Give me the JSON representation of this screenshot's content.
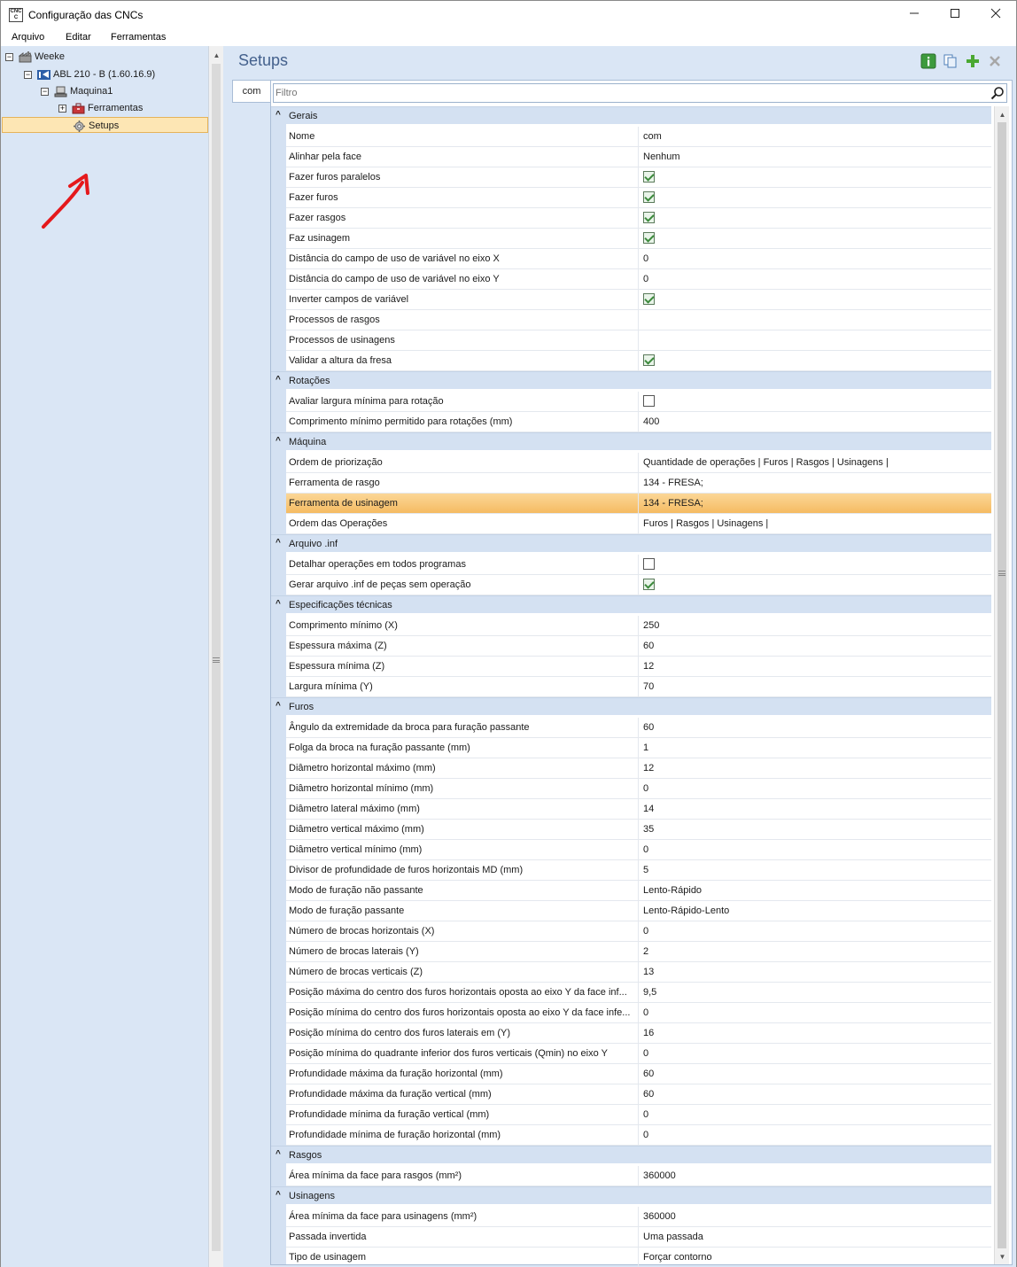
{
  "window": {
    "title": "Configuração das CNCs",
    "app_icon_text_top": "CNC",
    "app_icon_text_bottom": "C"
  },
  "menu": [
    "Arquivo",
    "Editar",
    "Ferramentas"
  ],
  "tree": [
    {
      "label": "Weeke",
      "level": 0,
      "expander": "−",
      "icon": "factory-icon"
    },
    {
      "label": "ABL 210 - B (1.60.16.9)",
      "level": 1,
      "expander": "−",
      "icon": "machine-icon"
    },
    {
      "label": "Maquina1",
      "level": 2,
      "expander": "−",
      "icon": "workstation-icon"
    },
    {
      "label": "Ferramentas",
      "level": 3,
      "expander": "+",
      "icon": "toolbox-icon"
    },
    {
      "label": "Setups",
      "level": 4,
      "expander": "",
      "icon": "gear-icon",
      "selected": true
    }
  ],
  "panel": {
    "title": "Setups",
    "tab": "com",
    "filter_placeholder": "Filtro"
  },
  "colors": {
    "pane_bg": "#dae6f5",
    "category_bg": "#d4e1f2",
    "highlight": "#f8c67c",
    "title_blue": "#44618d",
    "annotation_red": "#e5191c"
  },
  "properties": [
    {
      "category": "Gerais",
      "rows": [
        {
          "name": "Nome",
          "value": "com"
        },
        {
          "name": "Alinhar pela face",
          "value": "Nenhum"
        },
        {
          "name": "Fazer furos paralelos",
          "check": true
        },
        {
          "name": "Fazer furos",
          "check": true
        },
        {
          "name": "Fazer rasgos",
          "check": true
        },
        {
          "name": "Faz usinagem",
          "check": true
        },
        {
          "name": "Distância do campo de uso de variável no eixo X",
          "value": "0"
        },
        {
          "name": "Distância do campo de uso de variável no eixo Y",
          "value": "0"
        },
        {
          "name": "Inverter campos de variável",
          "check": true
        },
        {
          "name": "Processos de rasgos",
          "value": ""
        },
        {
          "name": "Processos de usinagens",
          "value": ""
        },
        {
          "name": "Validar a altura da fresa",
          "check": true
        }
      ]
    },
    {
      "category": "Rotações",
      "rows": [
        {
          "name": "Avaliar largura mínima para rotação",
          "check": false
        },
        {
          "name": "Comprimento mínimo permitido para rotações (mm)",
          "value": "400"
        }
      ]
    },
    {
      "category": "Máquina",
      "rows": [
        {
          "name": "Ordem de priorização",
          "value": "Quantidade de operações | Furos | Rasgos | Usinagens |"
        },
        {
          "name": "Ferramenta de rasgo",
          "value": "134 - FRESA;"
        },
        {
          "name": "Ferramenta de usinagem",
          "value": "134 - FRESA;",
          "highlight": true
        },
        {
          "name": "Ordem das Operações",
          "value": "Furos | Rasgos | Usinagens |"
        }
      ]
    },
    {
      "category": "Arquivo .inf",
      "rows": [
        {
          "name": "Detalhar operações em todos programas",
          "check": false
        },
        {
          "name": "Gerar arquivo .inf de peças sem operação",
          "check": true
        }
      ]
    },
    {
      "category": "Especificações técnicas",
      "rows": [
        {
          "name": "Comprimento mínimo (X)",
          "value": "250"
        },
        {
          "name": "Espessura máxima (Z)",
          "value": "60"
        },
        {
          "name": "Espessura mínima (Z)",
          "value": "12"
        },
        {
          "name": "Largura mínima (Y)",
          "value": "70"
        }
      ]
    },
    {
      "category": "Furos",
      "rows": [
        {
          "name": "Ângulo da extremidade da broca para furação passante",
          "value": "60"
        },
        {
          "name": "Folga da broca na furação passante (mm)",
          "value": "1"
        },
        {
          "name": "Diâmetro horizontal máximo (mm)",
          "value": "12"
        },
        {
          "name": "Diâmetro horizontal mínimo (mm)",
          "value": "0"
        },
        {
          "name": "Diâmetro lateral máximo (mm)",
          "value": "14"
        },
        {
          "name": "Diâmetro vertical máximo (mm)",
          "value": "35"
        },
        {
          "name": "Diâmetro vertical mínimo (mm)",
          "value": "0"
        },
        {
          "name": "Divisor de profundidade de furos horizontais MD (mm)",
          "value": "5"
        },
        {
          "name": "Modo de furação não passante",
          "value": "Lento-Rápido"
        },
        {
          "name": "Modo de furação passante",
          "value": "Lento-Rápido-Lento"
        },
        {
          "name": "Número de brocas horizontais (X)",
          "value": "0"
        },
        {
          "name": "Número de brocas laterais (Y)",
          "value": "2"
        },
        {
          "name": "Número de brocas verticais (Z)",
          "value": "13"
        },
        {
          "name": "Posição máxima do centro dos furos horizontais oposta ao eixo Y da face inf...",
          "value": "9,5"
        },
        {
          "name": "Posição mínima do centro dos furos horizontais oposta ao eixo Y da face infe...",
          "value": "0"
        },
        {
          "name": "Posição mínima do centro dos furos laterais em (Y)",
          "value": "16"
        },
        {
          "name": "Posição mínima do quadrante inferior dos furos verticais (Qmin) no eixo Y",
          "value": "0"
        },
        {
          "name": "Profundidade máxima da furação horizontal (mm)",
          "value": "60"
        },
        {
          "name": "Profundidade máxima da furação vertical (mm)",
          "value": "60"
        },
        {
          "name": "Profundidade mínima da furação vertical (mm)",
          "value": "0"
        },
        {
          "name": "Profundidade mínima de furação horizontal (mm)",
          "value": "0"
        }
      ]
    },
    {
      "category": "Rasgos",
      "rows": [
        {
          "name": "Área mínima da face para rasgos (mm²)",
          "value": "360000"
        }
      ]
    },
    {
      "category": "Usinagens",
      "rows": [
        {
          "name": "Área mínima da face para usinagens (mm²)",
          "value": "360000"
        },
        {
          "name": "Passada invertida",
          "value": "Uma passada"
        },
        {
          "name": "Tipo de usinagem",
          "value": "Forçar contorno"
        }
      ]
    }
  ]
}
